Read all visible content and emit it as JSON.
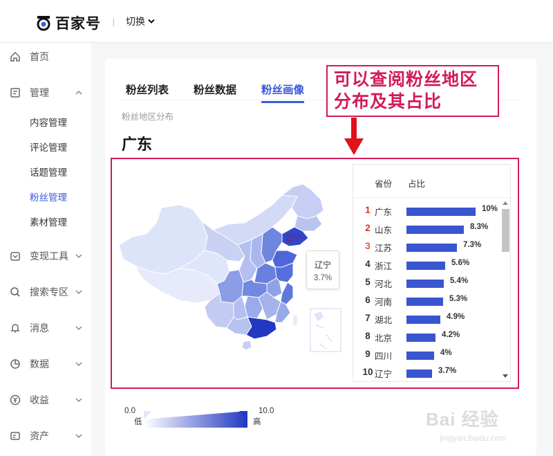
{
  "header": {
    "brand": "百家号",
    "switch_label": "切换"
  },
  "sidebar": {
    "items": [
      {
        "label": "首页",
        "icon": "home-icon"
      },
      {
        "label": "管理",
        "icon": "manage-icon",
        "expanded": true
      },
      {
        "label": "变现工具",
        "icon": "monetize-icon"
      },
      {
        "label": "搜索专区",
        "icon": "search-icon"
      },
      {
        "label": "消息",
        "icon": "bell-icon"
      },
      {
        "label": "数据",
        "icon": "pie-icon"
      },
      {
        "label": "收益",
        "icon": "yen-icon"
      },
      {
        "label": "资产",
        "icon": "wallet-icon"
      }
    ],
    "sub_items": [
      "内容管理",
      "评论管理",
      "话题管理",
      "粉丝管理",
      "素材管理"
    ],
    "active_sub": "粉丝管理"
  },
  "tabs": [
    {
      "label": "粉丝列表",
      "active": false
    },
    {
      "label": "粉丝数据",
      "active": false
    },
    {
      "label": "粉丝画像",
      "active": true
    }
  ],
  "section_title": "粉丝地区分布",
  "top_province": "广东",
  "annotation": {
    "line1": "可以查阅粉丝地区",
    "line2": "分布及其占比"
  },
  "tooltip": {
    "name": "辽宁",
    "value": "3.7%"
  },
  "map_label": "辽宁",
  "ranking": {
    "headers": {
      "province": "省份",
      "share": "占比"
    },
    "rows": [
      {
        "rank": "1",
        "province": "广东",
        "pct": "10%",
        "value": 10
      },
      {
        "rank": "2",
        "province": "山东",
        "pct": "8.3%",
        "value": 8.3
      },
      {
        "rank": "3",
        "province": "江苏",
        "pct": "7.3%",
        "value": 7.3
      },
      {
        "rank": "4",
        "province": "浙江",
        "pct": "5.6%",
        "value": 5.6
      },
      {
        "rank": "5",
        "province": "河北",
        "pct": "5.4%",
        "value": 5.4
      },
      {
        "rank": "6",
        "province": "河南",
        "pct": "5.3%",
        "value": 5.3
      },
      {
        "rank": "7",
        "province": "湖北",
        "pct": "4.9%",
        "value": 4.9
      },
      {
        "rank": "8",
        "province": "北京",
        "pct": "4.2%",
        "value": 4.2
      },
      {
        "rank": "9",
        "province": "四川",
        "pct": "4%",
        "value": 4
      },
      {
        "rank": "10",
        "province": "辽宁",
        "pct": "3.7%",
        "value": 3.7
      }
    ]
  },
  "legend": {
    "min": "0.0",
    "max": "10.0",
    "low": "低",
    "high": "高"
  },
  "watermark": {
    "text": "Bai 经验",
    "url": "jingyan.baidu.com"
  },
  "colors": {
    "accent": "#3a5bd9",
    "bar": "#3a55d0",
    "annotation": "#d21a5b"
  }
}
